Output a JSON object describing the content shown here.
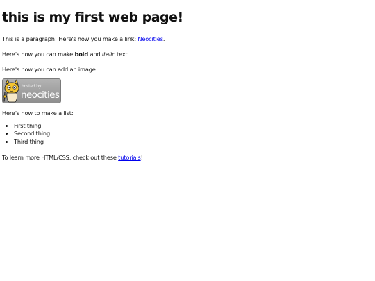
{
  "page": {
    "heading": "this is my first web page!",
    "para1": {
      "prefix": "This is a paragraph! Here's how you make a link: ",
      "link": "Neocities",
      "suffix": "."
    },
    "para2": {
      "prefix": "Here's how you can make ",
      "bold": "bold",
      "middle": " and ",
      "italic": "italic",
      "suffix": " text."
    },
    "para3": "Here's how you can add an image:",
    "image": {
      "badge_line1": "hosted by",
      "badge_line2": "neocities",
      "icon": "neocities-cat-logo"
    },
    "para4": "Here's how to make a list:",
    "list": [
      "First thing",
      "Second thing",
      "Third thing"
    ],
    "para5": {
      "prefix": "To learn more HTML/CSS, check out these ",
      "link": "tutorials",
      "suffix": "!"
    }
  },
  "colors": {
    "link": "#0000ee",
    "text": "#111111",
    "badge_bg": "#9a9a9a"
  }
}
